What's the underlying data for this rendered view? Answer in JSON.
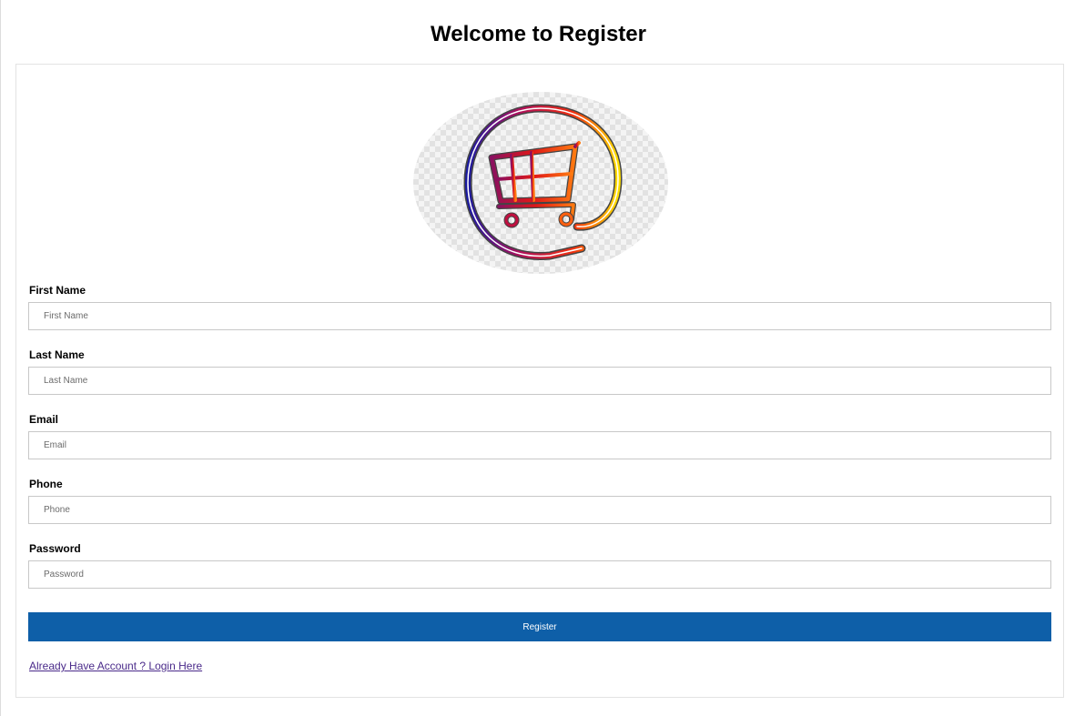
{
  "header": {
    "title": "Welcome to Register"
  },
  "form": {
    "fields": [
      {
        "label": "First Name",
        "placeholder": "First Name",
        "value": ""
      },
      {
        "label": "Last Name",
        "placeholder": "Last Name",
        "value": ""
      },
      {
        "label": "Email",
        "placeholder": "Email",
        "value": ""
      },
      {
        "label": "Phone",
        "placeholder": "Phone",
        "value": ""
      },
      {
        "label": "Password",
        "placeholder": "Password",
        "value": ""
      }
    ],
    "submit_label": "Register",
    "login_link": "Already Have Account ? Login Here"
  },
  "logo": {
    "icon": "shopping-cart-logo-icon"
  },
  "colors": {
    "primary_button": "#0e5fa8",
    "link": "#4a2a8a"
  }
}
